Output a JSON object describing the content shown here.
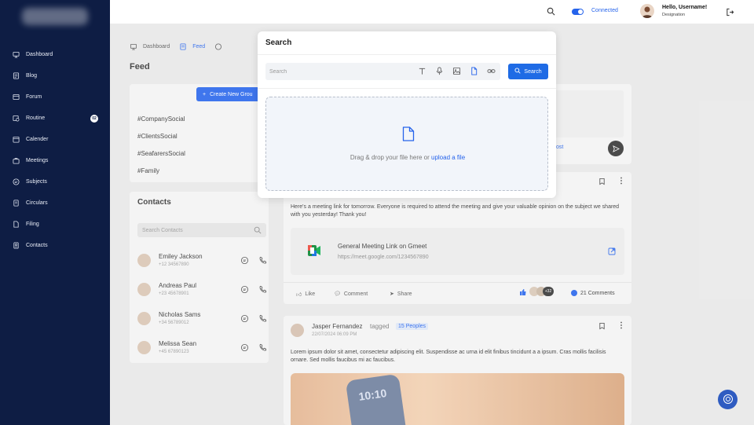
{
  "sidebar": {
    "items": [
      {
        "label": "Dashboard",
        "icon": "monitor-icon"
      },
      {
        "label": "Blog",
        "icon": "blog-icon"
      },
      {
        "label": "Forum",
        "icon": "forum-icon"
      },
      {
        "label": "Routine",
        "icon": "routine-icon",
        "badge": "02"
      },
      {
        "label": "Calender",
        "icon": "calendar-icon"
      },
      {
        "label": "Meetings",
        "icon": "meetings-icon"
      },
      {
        "label": "Subjects",
        "icon": "subjects-icon"
      },
      {
        "label": "Circulars",
        "icon": "circulars-icon"
      },
      {
        "label": "Filing",
        "icon": "file-icon"
      },
      {
        "label": "Contacts",
        "icon": "contacts-icon"
      }
    ]
  },
  "topbar": {
    "status": "Connected",
    "greeting": "Hello, Username!",
    "designation": "Designation"
  },
  "breadcrumb": {
    "items": [
      "Dashboard",
      "Feed"
    ]
  },
  "page": {
    "title": "Feed",
    "create_group": "Create New Grou"
  },
  "tags": [
    "#CompanySocial",
    "#ClientsSocial",
    "#SeafarersSocial",
    "#Family"
  ],
  "contacts": {
    "title": "Contacts",
    "search_placeholder": "Search Contacts",
    "list": [
      {
        "name": "Emiley Jackson",
        "phone": "+12 34567890"
      },
      {
        "name": "Andreas Paul",
        "phone": "+23 45678901"
      },
      {
        "name": "Nicholas Sams",
        "phone": "+34 56789012"
      },
      {
        "name": "Melissa Sean",
        "phone": "+45 67890123"
      }
    ]
  },
  "composer": {
    "post_label": "ost"
  },
  "post1": {
    "text": "Here's a meeting link for tomorrow. Everyone is required to attend the meeting and give your valuable opinion on the subject we shared with you yesterday! Thank you!",
    "link_title": "General Meeting Link on Gmeet",
    "link_url": "https://meet.google.com/1234567890",
    "like": "Like",
    "comment": "Comment",
    "share": "Share",
    "more_count": "+32",
    "comments": "21 Comments"
  },
  "post2": {
    "author": "Jasper Fernandez",
    "tagged": "tagged",
    "peoples": "15 Peoples",
    "date": "22/07/2024 06:09 PM",
    "text": "Lorem ipsum dolor sit amet, consectetur adipiscing elit. Suspendisse ac urna id elit finibus tincidunt a a ipsum. Cras mollis facilisis ornare. Sed mollis faucibus mi ac faucibus.",
    "image_time": "10:10"
  },
  "modal": {
    "title": "Search",
    "search_placeholder": "Search",
    "search_button": "Search",
    "drop_text": "Drag & drop your file here or ",
    "upload_link": "upload a file"
  },
  "colors": {
    "sidebar": "#0e1d44",
    "accent": "#2563eb",
    "modal_bg": "#ffffff",
    "dropzone_bg": "#f2f5fa"
  }
}
